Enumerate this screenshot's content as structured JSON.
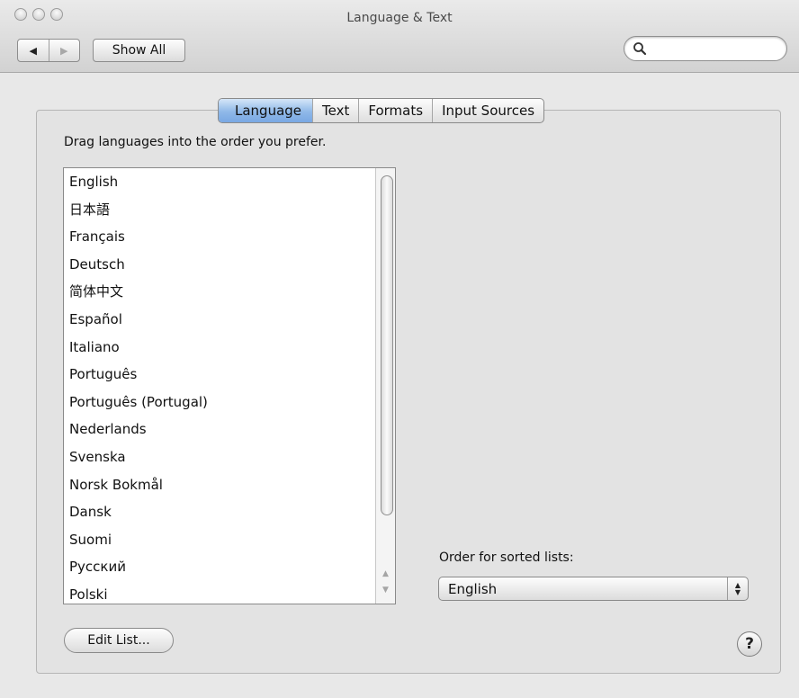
{
  "window": {
    "title": "Language & Text"
  },
  "toolbar": {
    "back_glyph": "◀",
    "forward_glyph": "▶",
    "show_all_label": "Show All",
    "search": {
      "value": "",
      "placeholder": "",
      "icon": "search-icon"
    }
  },
  "tabs": [
    {
      "label": "Language",
      "active": true
    },
    {
      "label": "Text",
      "active": false
    },
    {
      "label": "Formats",
      "active": false
    },
    {
      "label": "Input Sources",
      "active": false
    }
  ],
  "language_pane": {
    "instruction": "Drag languages into the order you prefer.",
    "languages": [
      "English",
      "日本語",
      "Français",
      "Deutsch",
      "简体中文",
      "Español",
      "Italiano",
      "Português",
      "Português (Portugal)",
      "Nederlands",
      "Svenska",
      "Norsk Bokmål",
      "Dansk",
      "Suomi",
      "Русский",
      "Polski"
    ],
    "edit_list_label": "Edit List...",
    "sort_order_label": "Order for sorted lists:",
    "sort_order_value": "English",
    "help_glyph": "?"
  },
  "colors": {
    "active_tab": "#79a8e3",
    "window_bg": "#e8e8e8"
  }
}
